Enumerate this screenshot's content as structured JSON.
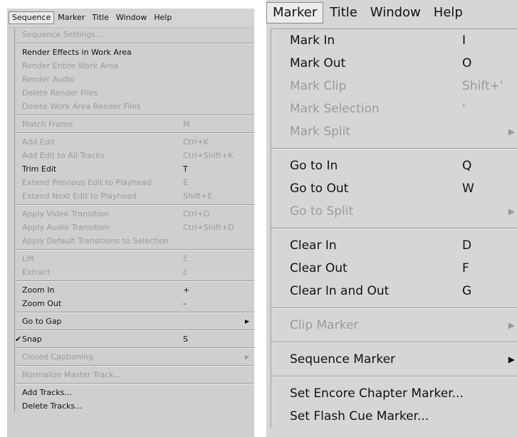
{
  "left": {
    "menubar": [
      "Sequence",
      "Marker",
      "Title",
      "Window",
      "Help"
    ],
    "active_index": 0,
    "items": [
      {
        "t": "item",
        "label": "Sequence Settings...",
        "shortcut": "",
        "disabled": true
      },
      {
        "t": "sep"
      },
      {
        "t": "item",
        "label": "Render Effects in Work Area",
        "shortcut": "",
        "disabled": false
      },
      {
        "t": "item",
        "label": "Render Entire Work Area",
        "shortcut": "",
        "disabled": true
      },
      {
        "t": "item",
        "label": "Render Audio",
        "shortcut": "",
        "disabled": true
      },
      {
        "t": "item",
        "label": "Delete Render Files",
        "shortcut": "",
        "disabled": true
      },
      {
        "t": "item",
        "label": "Delete Work Area Render Files",
        "shortcut": "",
        "disabled": true
      },
      {
        "t": "sep"
      },
      {
        "t": "item",
        "label": "Match Frame",
        "shortcut": "M",
        "disabled": true
      },
      {
        "t": "sep"
      },
      {
        "t": "item",
        "label": "Add Edit",
        "shortcut": "Ctrl+K",
        "disabled": true
      },
      {
        "t": "item",
        "label": "Add Edit to All Tracks",
        "shortcut": "Ctrl+Shift+K",
        "disabled": true
      },
      {
        "t": "item",
        "label": "Trim Edit",
        "shortcut": "T",
        "disabled": false
      },
      {
        "t": "item",
        "label": "Extend Previous Edit to Playhead",
        "shortcut": "E",
        "disabled": true
      },
      {
        "t": "item",
        "label": "Extend Next Edit to Playhead",
        "shortcut": "Shift+E",
        "disabled": true
      },
      {
        "t": "sep"
      },
      {
        "t": "item",
        "label": "Apply Video Transition",
        "shortcut": "Ctrl+D",
        "disabled": true
      },
      {
        "t": "item",
        "label": "Apply Audio Transition",
        "shortcut": "Ctrl+Shift+D",
        "disabled": true
      },
      {
        "t": "item",
        "label": "Apply Default Transitions to Selection",
        "shortcut": "",
        "disabled": true
      },
      {
        "t": "sep"
      },
      {
        "t": "item",
        "label": "Lift",
        "shortcut": "č",
        "disabled": true
      },
      {
        "t": "item",
        "label": "Extract",
        "shortcut": "ć",
        "disabled": true
      },
      {
        "t": "sep"
      },
      {
        "t": "item",
        "label": "Zoom In",
        "shortcut": "+",
        "disabled": false
      },
      {
        "t": "item",
        "label": "Zoom Out",
        "shortcut": "-",
        "disabled": false
      },
      {
        "t": "sep"
      },
      {
        "t": "item",
        "label": "Go to Gap",
        "shortcut": "",
        "disabled": false,
        "submenu": true
      },
      {
        "t": "sep"
      },
      {
        "t": "item",
        "label": "Snap",
        "shortcut": "S",
        "disabled": false,
        "checked": true
      },
      {
        "t": "sep"
      },
      {
        "t": "item",
        "label": "Closed Captioning",
        "shortcut": "",
        "disabled": true,
        "submenu": true
      },
      {
        "t": "sep"
      },
      {
        "t": "item",
        "label": "Normalize Master Track...",
        "shortcut": "",
        "disabled": true
      },
      {
        "t": "sep"
      },
      {
        "t": "item",
        "label": "Add Tracks...",
        "shortcut": "",
        "disabled": false
      },
      {
        "t": "item",
        "label": "Delete Tracks...",
        "shortcut": "",
        "disabled": false
      }
    ]
  },
  "right": {
    "menubar": [
      "Marker",
      "Title",
      "Window",
      "Help"
    ],
    "active_index": 0,
    "items": [
      {
        "t": "item",
        "label": "Mark In",
        "shortcut": "I",
        "disabled": false
      },
      {
        "t": "item",
        "label": "Mark Out",
        "shortcut": "O",
        "disabled": false
      },
      {
        "t": "item",
        "label": "Mark Clip",
        "shortcut": "Shift+'",
        "disabled": true
      },
      {
        "t": "item",
        "label": "Mark Selection",
        "shortcut": "'",
        "disabled": true
      },
      {
        "t": "item",
        "label": "Mark Split",
        "shortcut": "",
        "disabled": true,
        "submenu": true
      },
      {
        "t": "sep"
      },
      {
        "t": "item",
        "label": "Go to In",
        "shortcut": "Q",
        "disabled": false
      },
      {
        "t": "item",
        "label": "Go to Out",
        "shortcut": "W",
        "disabled": false
      },
      {
        "t": "item",
        "label": "Go to Split",
        "shortcut": "",
        "disabled": true,
        "submenu": true
      },
      {
        "t": "sep"
      },
      {
        "t": "item",
        "label": "Clear In",
        "shortcut": "D",
        "disabled": false
      },
      {
        "t": "item",
        "label": "Clear Out",
        "shortcut": "F",
        "disabled": false
      },
      {
        "t": "item",
        "label": "Clear In and Out",
        "shortcut": "G",
        "disabled": false
      },
      {
        "t": "sep"
      },
      {
        "t": "item",
        "label": "Clip Marker",
        "shortcut": "",
        "disabled": true,
        "submenu": true
      },
      {
        "t": "sep"
      },
      {
        "t": "item",
        "label": "Sequence Marker",
        "shortcut": "",
        "disabled": false,
        "submenu": true
      },
      {
        "t": "sep"
      },
      {
        "t": "item",
        "label": "Set Encore Chapter Marker...",
        "shortcut": "",
        "disabled": false
      },
      {
        "t": "item",
        "label": "Set Flash Cue Marker...",
        "shortcut": "",
        "disabled": false
      }
    ]
  },
  "icons": {
    "submenu": "triangle-right-icon",
    "check": "check-icon"
  }
}
